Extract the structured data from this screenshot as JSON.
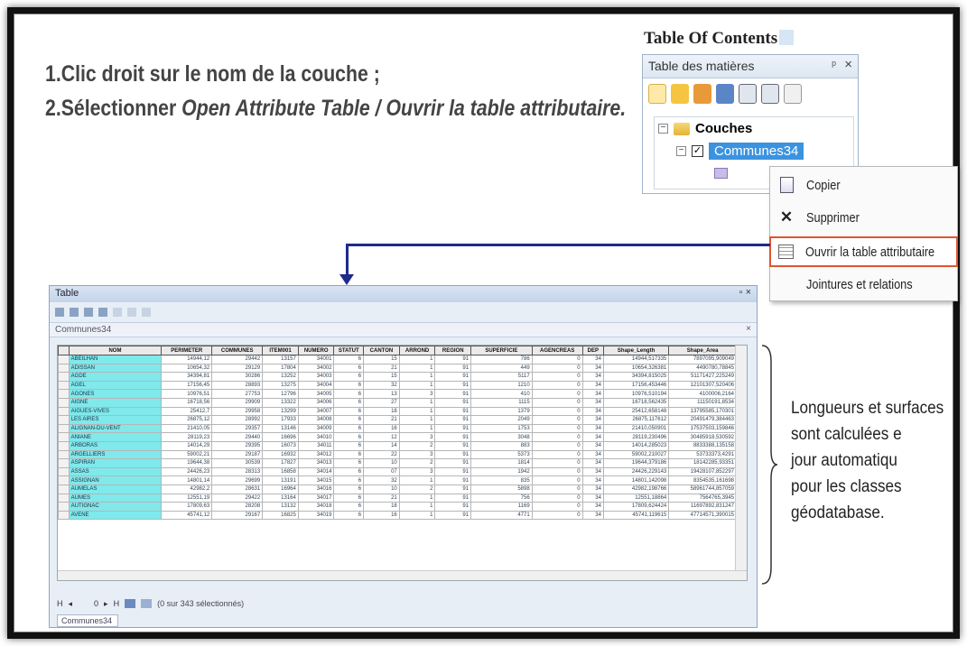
{
  "instructions": {
    "step1": "1.Clic droit sur le nom de la couche ;",
    "step2_prefix": "2.Sélectionner ",
    "step2_italic": "Open Attribute Table / Ouvrir la table attributaire."
  },
  "toc": {
    "caption": "Table Of Contents",
    "window_title": "Table des matières",
    "pin_glyph": "ᵖ",
    "close_glyph": "×",
    "group_label": "Couches",
    "layer_label": "Communes34"
  },
  "context_menu": {
    "items": [
      {
        "label": "Copier",
        "icon": "copy-icon"
      },
      {
        "label": "Supprimer",
        "icon": "delete-icon",
        "glyph": "✕"
      },
      {
        "label": "Ouvrir la table attributaire",
        "icon": "table-icon",
        "highlighted": true
      },
      {
        "label": "Jointures et relations",
        "icon": ""
      }
    ]
  },
  "table_window": {
    "title": "Table",
    "tab_label": "Communes34",
    "columns": [
      "NOM",
      "PERIMETER",
      "COMMUNES",
      "ITEM001",
      "NUMERO",
      "STATUT",
      "CANTON",
      "ARROND",
      "REGION",
      "SUPERFICIE",
      "AGENCREAS",
      "DEP",
      "Shape_Length",
      "Shape_Area"
    ],
    "rows": [
      [
        "ABEILHAN",
        "14944,12",
        "29442",
        "13157",
        "34001",
        "6",
        "15",
        "1",
        "91",
        "786",
        "0",
        "34",
        "14944,517335",
        "7897095,909049"
      ],
      [
        "ADISSAN",
        "10654,32",
        "29129",
        "17804",
        "34002",
        "6",
        "21",
        "1",
        "91",
        "449",
        "0",
        "34",
        "10654,326381",
        "4490780,78845"
      ],
      [
        "AGDE",
        "34394,81",
        "30286",
        "13252",
        "34003",
        "6",
        "15",
        "1",
        "91",
        "5117",
        "0",
        "34",
        "34394,815025",
        "51171427,225249"
      ],
      [
        "AGEL",
        "17156,45",
        "28893",
        "13275",
        "34004",
        "6",
        "32",
        "1",
        "91",
        "1210",
        "0",
        "34",
        "17156,453446",
        "12101307,520406"
      ],
      [
        "AGONES",
        "10976,51",
        "27753",
        "12796",
        "34005",
        "6",
        "13",
        "3",
        "91",
        "410",
        "0",
        "34",
        "10976,510194",
        "4100006,2164"
      ],
      [
        "AIGNE",
        "16718,56",
        "29909",
        "13322",
        "34006",
        "6",
        "27",
        "1",
        "91",
        "1115",
        "0",
        "34",
        "16718,562435",
        "11150191,8534"
      ],
      [
        "AIGUES-VIVES",
        "25412,7",
        "29958",
        "13299",
        "34007",
        "6",
        "18",
        "1",
        "91",
        "1379",
        "0",
        "34",
        "25412,658148",
        "13795585,170301"
      ],
      [
        "LES AIRES",
        "26875,12",
        "28992",
        "17933",
        "34008",
        "6",
        "21",
        "1",
        "91",
        "2049",
        "0",
        "34",
        "26875,117612",
        "20491479,384463"
      ],
      [
        "ALIGNAN-DU-VENT",
        "21410,05",
        "29357",
        "13146",
        "34009",
        "6",
        "16",
        "1",
        "91",
        "1753",
        "0",
        "34",
        "21410,050901",
        "17537503,159846"
      ],
      [
        "ANIANE",
        "28119,23",
        "29440",
        "16696",
        "34010",
        "6",
        "12",
        "3",
        "91",
        "3048",
        "0",
        "34",
        "28119,230496",
        "30485918,530592"
      ],
      [
        "ARBORAS",
        "14014,29",
        "29395",
        "16073",
        "34011",
        "6",
        "14",
        "2",
        "91",
        "883",
        "0",
        "34",
        "14014,285023",
        "8833388,135158"
      ],
      [
        "ARGELLIERS",
        "59002,21",
        "29187",
        "16932",
        "34012",
        "6",
        "22",
        "3",
        "91",
        "5373",
        "0",
        "34",
        "59002,210027",
        "53733373,4291"
      ],
      [
        "ASPIRAN",
        "19644,38",
        "30539",
        "17827",
        "34013",
        "6",
        "10",
        "2",
        "91",
        "1814",
        "0",
        "34",
        "19644,379186",
        "18142285,93351"
      ],
      [
        "ASSAS",
        "24426,23",
        "28313",
        "16858",
        "34014",
        "6",
        "07",
        "3",
        "91",
        "1942",
        "0",
        "34",
        "24426,229143",
        "19428107,852297"
      ],
      [
        "ASSIGNAN",
        "14801,14",
        "29699",
        "13191",
        "34015",
        "6",
        "32",
        "1",
        "91",
        "835",
        "0",
        "34",
        "14801,142098",
        "8354535,161698"
      ],
      [
        "AUMELAS",
        "42982,2",
        "28631",
        "16964",
        "34016",
        "6",
        "10",
        "2",
        "91",
        "5898",
        "0",
        "34",
        "42982,198766",
        "58961744,857059"
      ],
      [
        "AUMES",
        "12551,19",
        "29422",
        "13164",
        "34017",
        "6",
        "21",
        "1",
        "91",
        "756",
        "0",
        "34",
        "12551,18864",
        "7564765,3945"
      ],
      [
        "AUTIGNAC",
        "17809,63",
        "28208",
        "13132",
        "34018",
        "6",
        "18",
        "1",
        "91",
        "1169",
        "0",
        "34",
        "17809,624424",
        "11697892,831247"
      ],
      [
        "AVENE",
        "45741,12",
        "29167",
        "16825",
        "34019",
        "6",
        "16",
        "1",
        "91",
        "4771",
        "0",
        "34",
        "45741,119615",
        "47714571,390015"
      ]
    ],
    "footer_status": "(0 sur 343 sélectionnés)",
    "nav_first": "H",
    "nav_prev": "◂",
    "nav_record": "0",
    "nav_next": "▸",
    "nav_last": "H",
    "bottom_tab": "Communes34"
  },
  "side_note": {
    "lines": [
      "Longueurs et surfaces",
      "sont calculées e",
      "jour automatiqu",
      "pour les classes",
      "géodatabase."
    ]
  },
  "colors": {
    "arrow": "#1e2a8c",
    "highlight_border": "#e2532f",
    "selected_layer": "#3b93e0",
    "name_cells": "#7fe9ec"
  }
}
